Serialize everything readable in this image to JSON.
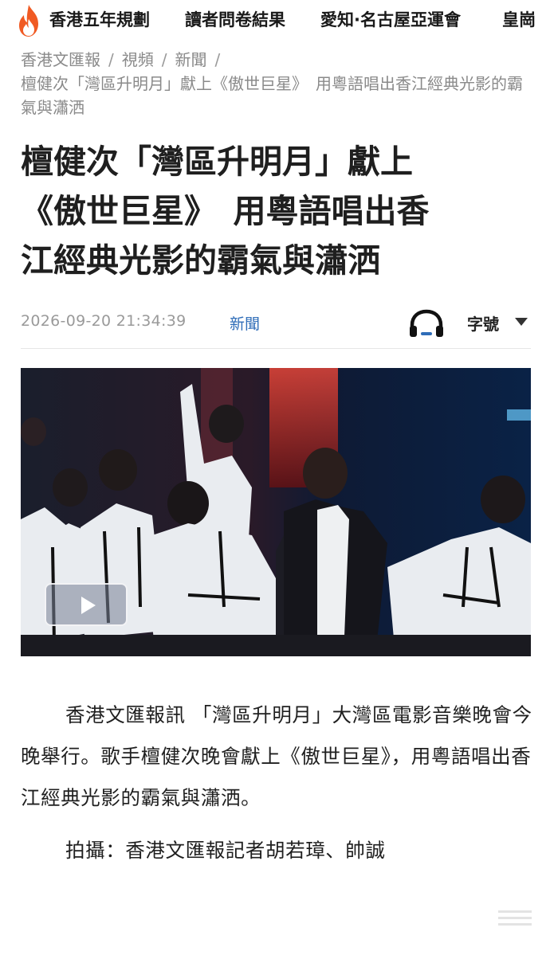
{
  "topnav": {
    "logo_icon": "flame-icon",
    "items": [
      "香港五年規劃",
      "讀者問卷結果",
      "愛知·名古屋亞運會",
      "皇崗"
    ]
  },
  "breadcrumb": {
    "items": [
      "香港文匯報",
      "視頻",
      "新聞"
    ],
    "separator": "/",
    "title": "檀健次「灣區升明月」獻上《傲世巨星》　用粵語唱出香江經典光影的霸氣與瀟洒"
  },
  "article": {
    "headline_lines": [
      "檀健次「灣區升明月」獻上",
      "《傲世巨星》　用粵語唱出香",
      "江經典光影的霸氣與瀟洒"
    ],
    "datetime": "2026-09-20 21:34:39",
    "category": "新聞",
    "font_size_label": "字號",
    "body": "香港文匯報訊 「灣區升明月」大灣區電影音樂晚會今晚舉行。歌手檀健次晚會獻上《傲世巨星》，用粵語唱出香江經典光影的霸氣與瀟洒。",
    "credit": "拍攝：香港文匯報記者胡若璋、帥誠"
  },
  "video": {
    "play_icon": "play-icon"
  },
  "colors": {
    "accent_blue": "#2f6db8",
    "flame_orange": "#f05a23",
    "meta_gray": "#9a9a9a"
  }
}
